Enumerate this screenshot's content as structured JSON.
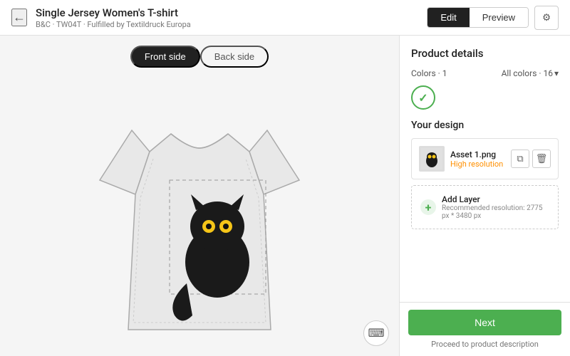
{
  "topbar": {
    "back_icon": "←",
    "title": "Single Jersey Women's T-shirt",
    "subtitle": "B&C · TW04T · Fulfilled by Textildruck Europa",
    "btn_edit": "Edit",
    "btn_preview": "Preview",
    "gear_icon": "⚙"
  },
  "canvas": {
    "tab_front": "Front side",
    "tab_back": "Back side",
    "keyboard_icon": "⌨"
  },
  "right_panel": {
    "section_title": "Product details",
    "colors_label": "Colors · 1",
    "all_colors_label": "All colors · 16",
    "check_icon": "✓",
    "your_design_title": "Your design",
    "asset": {
      "name": "Asset 1.png",
      "quality": "High resolution",
      "copy_icon": "⧉",
      "delete_icon": "🗑"
    },
    "add_layer": {
      "title": "Add Layer",
      "subtitle": "Recommended resolution: 2775 px * 3480 px",
      "icon": "+"
    },
    "btn_next": "Next",
    "proceed_text": "Proceed to product description"
  }
}
